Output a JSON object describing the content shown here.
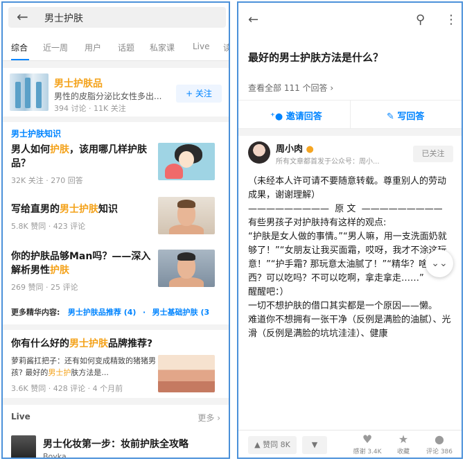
{
  "left": {
    "search": {
      "query": "男士护肤"
    },
    "tabs": [
      "综合",
      "近一周",
      "用户",
      "话题",
      "私家课",
      "Live",
      "读"
    ],
    "topic": {
      "title": "男士护肤品",
      "desc": "男性的皮脂分泌比女性多出...",
      "meta": "394 讨论 · 11K 关注",
      "follow_label": "+ 关注"
    },
    "knowledge": {
      "section_title": "男士护肤知识",
      "items": [
        {
          "title_pre": "男人如何",
          "title_hl": "护肤",
          "title_post": "，该用哪几样护肤品？",
          "meta": "32K 关注 · 270 回答"
        },
        {
          "title_pre": "写给直男的",
          "title_hl": "男士护肤",
          "title_post": "知识",
          "meta": "5.8K 赞同 · 423 评论"
        },
        {
          "title_pre": "你的护肤品够Man吗？——深入解析男性",
          "title_hl": "护肤",
          "title_post": "",
          "meta": "269 赞同 · 25 评论"
        }
      ],
      "more_label": "更多精华内容:",
      "more_links": [
        "男士护肤品推荐 (4)",
        "·",
        "男士基础护肤 (3"
      ]
    },
    "answer": {
      "title_pre": "你有什么好的",
      "title_hl": "男士护肤",
      "title_post": "品牌推荐?",
      "snippet_pre": "萝莉酱扛把子：还有如何变成精致的猪猪男孩? 最好的",
      "snippet_hl": "男士护",
      "snippet_post": "肤方法是...",
      "meta": "3.6K 赞同 · 428 评论 · 4 个月前"
    },
    "live": {
      "section_title": "Live",
      "more_label": "更多 ›",
      "item_title": "男士化妆第一步：妆前护肤全攻略",
      "item_author": "Boyka"
    }
  },
  "right": {
    "question": "最好的男士护肤方法是什么？",
    "view_all": "查看全部 111 个回答 ›",
    "invite_label": "邀请回答",
    "write_label": "写回答",
    "author": {
      "name": "周小肉",
      "sub": "所有文章都首发于公众号：周小...",
      "followed_label": "已关注"
    },
    "body": [
      "（未经本人许可请不要随意转载。尊重别人的劳动成果，谢谢理解）",
      "—————————  原 文  —————————",
      "有些男孩子对护肤持有这样的观点:",
      "“护肤是女人做的事情。”“男人嘛，用一支洗面奶就够了！”“女朋友让我买面霜，哎呀，我才不涂这玩意！”“护手霜? 那玩意太油腻了！”“精华？啥东西？可以吃吗？不可以吃啊，拿走拿走……”",
      "",
      "醒醒吧：）",
      "",
      "一切不想护肤的借口其实都是一个原因——懒。",
      "",
      "难道你不想拥有一张干净（反例是满脸的油腻）、光滑（反例是满脸的坑坑洼洼）、健康"
    ],
    "bottom": {
      "upvote_label": "▲ 赞同 8K",
      "downvote_label": "▼",
      "thanks_label": "感谢 3.4K",
      "collect_label": "收藏",
      "comment_label": "评论 386"
    }
  }
}
